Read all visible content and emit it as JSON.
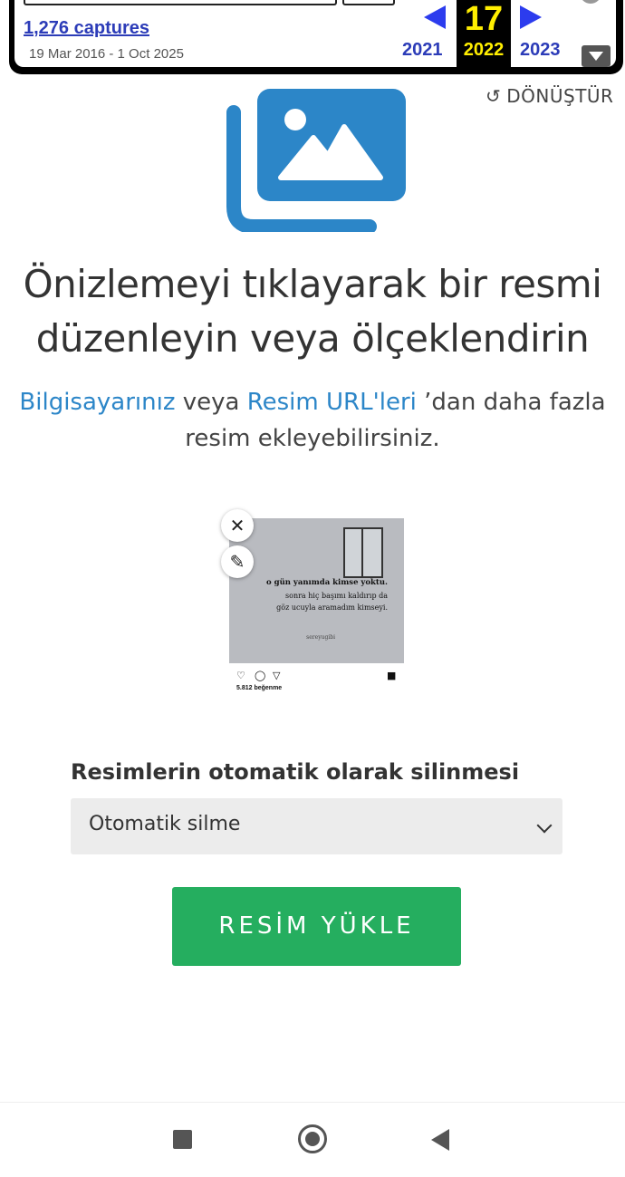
{
  "wayback": {
    "captures_label": "1,276 captures",
    "date_range": "19 Mar 2016 - 1 Oct 2025",
    "prev_year": "2021",
    "current_day": "17",
    "current_year": "2022",
    "next_year": "2023"
  },
  "reset_label": "DÖNÜŞTÜR",
  "headline": "Önizlemeyi tıklayarak bir resmi düzenleyin veya ölçeklendirin",
  "sub": {
    "link_computer": "Bilgisayarınız",
    "veya": " veya ",
    "link_url": "Resim URL'leri",
    "rest": " ’dan daha fazla resim ekleyebilirsiniz."
  },
  "preview": {
    "quote_line1": "o gün yanımda kimse yoktu.",
    "quote_line2": "sonra hiç başımı kaldırıp da",
    "quote_line3": "göz ucuyla aramadım kimseyi.",
    "quote_author": "sereyugibi",
    "likes": "5.812 beğenme"
  },
  "auto_delete": {
    "label": "Resimlerin otomatik olarak silinmesi",
    "selected": "Otomatik silme"
  },
  "upload_button": "RESİM YÜKLE",
  "colors": {
    "accent_blue": "#2c86c8",
    "upload_green": "#25ae5f",
    "wayback_link": "#2c3cb8",
    "wayback_highlight": "#ffee00"
  }
}
